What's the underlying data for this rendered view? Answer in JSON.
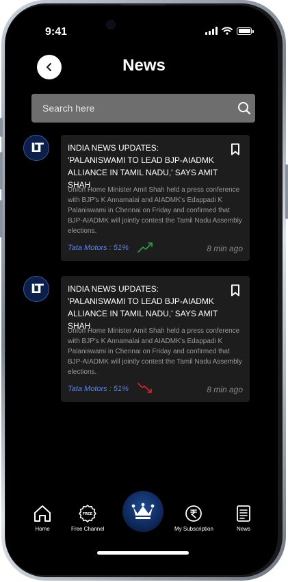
{
  "status": {
    "time": "9:41"
  },
  "header": {
    "title": "News"
  },
  "search": {
    "placeholder": "Search here"
  },
  "news": [
    {
      "title": "INDIA NEWS UPDATES: 'PALANISWAMI TO LEAD BJP-AIADMK ALLIANCE IN TAMIL NADU,' SAYS AMIT SHAH",
      "body": "Union Home Minister Amit Shah held a press conference with BJP's K Annamalai and AIADMK's Edappadi K Palaniswami in Chennai on Friday and confirmed that BJP-AIADMK will jointly contest the Tamil Nadu Assembly elections.",
      "ticker": "Tata Motors : 51%",
      "trend": "up",
      "trend_color": "#22a844",
      "time_ago": "8 min ago"
    },
    {
      "title": "INDIA NEWS UPDATES: 'PALANISWAMI TO LEAD BJP-AIADMK ALLIANCE IN TAMIL NADU,' SAYS AMIT SHAH",
      "body": "Union Home Minister Amit Shah held a press conference with BJP's K Annamalai and AIADMK's Edappadi K Palaniswami in Chennai on Friday and confirmed that BJP-AIADMK will jointly contest the Tamil Nadu Assembly elections.",
      "ticker": "Tata Motors : 51%",
      "trend": "down",
      "trend_color": "#e0242a",
      "time_ago": "8 min ago"
    }
  ],
  "nav": {
    "home": "Home",
    "free_channel": "Free Channel",
    "free_badge": "FREE",
    "subscription": "My Subscription",
    "news": "News"
  },
  "colors": {
    "accent": "#5a86e6",
    "crown_bg": "#0c2350"
  }
}
